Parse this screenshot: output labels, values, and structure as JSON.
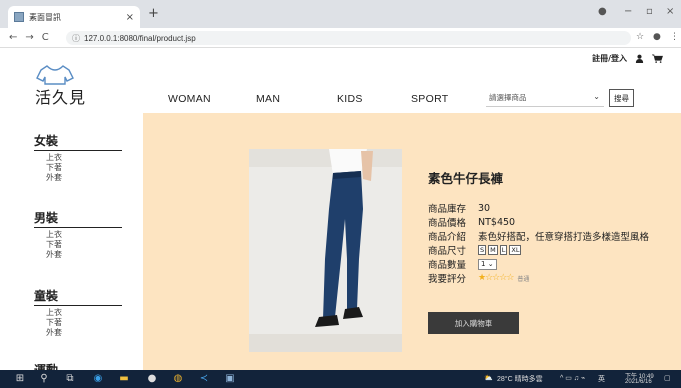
{
  "browser": {
    "tab_title": "素面冒訊",
    "tab_close": "×",
    "new_tab": "+",
    "url": "127.0.0.1:8080/final/product.jsp",
    "win_min": "−",
    "win_max": "▫",
    "win_close": "×"
  },
  "header": {
    "logo_text": "活久見",
    "login": "註冊/登入",
    "nav": [
      "WOMAN",
      "MAN",
      "KIDS",
      "SPORT"
    ],
    "select_placeholder": "請選擇商品",
    "search_button": "搜尋"
  },
  "sidebar": {
    "categories": [
      {
        "title": "女裝",
        "items": [
          "上衣",
          "下著",
          "外套"
        ]
      },
      {
        "title": "男裝",
        "items": [
          "上衣",
          "下著",
          "外套"
        ]
      },
      {
        "title": "童裝",
        "items": [
          "上衣",
          "下著",
          "外套"
        ]
      },
      {
        "title": "運動",
        "items": []
      }
    ]
  },
  "product": {
    "title": "素色牛仔長褲",
    "stock_label": "商品庫存",
    "stock_value": "30",
    "price_label": "商品價格",
    "price_value": "NT$450",
    "desc_label": "商品介紹",
    "desc_value": "素色好搭配，任意穿搭打造多樣造型風格",
    "size_label": "商品尺寸",
    "sizes": [
      "S",
      "M",
      "L",
      "XL"
    ],
    "qty_label": "商品數量",
    "qty_value": "1",
    "rating_label": "我要評分",
    "rating": 1,
    "rating_max": 5,
    "rating_hint": "普通",
    "cart_button": "加入購物車"
  },
  "taskbar": {
    "weather": "28°C 晴時多雲",
    "ime": "英",
    "time": "下午 10:49",
    "date": "2021/6/16"
  },
  "colors": {
    "main_bg": "#fde4c1",
    "cart_button_bg": "#3a3a3a",
    "star": "#f2b01e",
    "taskbar": "#12233a"
  }
}
